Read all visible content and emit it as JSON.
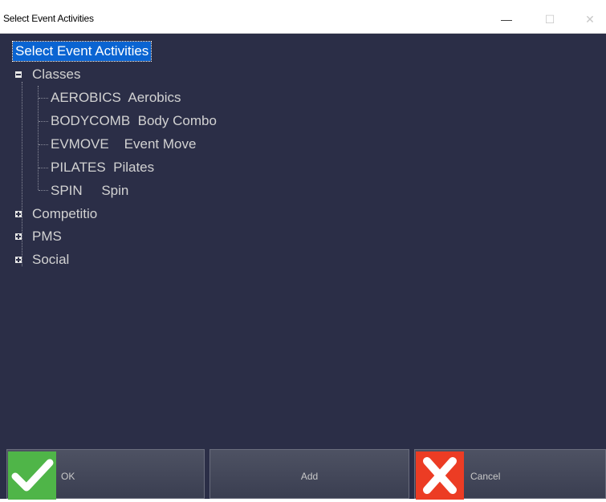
{
  "window": {
    "title": "Select Event Activities",
    "minimize": "—",
    "maximize": "☐",
    "close": "✕"
  },
  "tree": {
    "root_label": "Select Event Activities",
    "groups": [
      {
        "label": "Classes",
        "expanded": true,
        "children": [
          {
            "code": "AEROBICS",
            "name": "Aerobics"
          },
          {
            "code": "BODYCOMB",
            "name": "Body Combo"
          },
          {
            "code": "EVMOVE",
            "name": "Event Move"
          },
          {
            "code": "PILATES",
            "name": "Pilates"
          },
          {
            "code": "SPIN",
            "name": "Spin"
          }
        ]
      },
      {
        "label": "Competitio",
        "expanded": false
      },
      {
        "label": "PMS",
        "expanded": false
      },
      {
        "label": "Social",
        "expanded": false
      }
    ]
  },
  "buttons": {
    "ok": "OK",
    "add": "Add",
    "cancel": "Cancel"
  },
  "colors": {
    "panel_bg": "#2b2e47",
    "selection": "#0a64d2",
    "ok_icon": "#4fb548",
    "cancel_icon": "#ec3c24"
  }
}
